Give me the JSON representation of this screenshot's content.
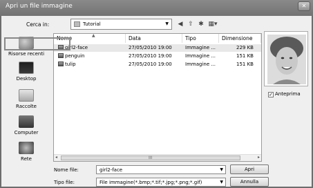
{
  "window": {
    "title": "Apri un file immagine",
    "close": "✕"
  },
  "lookin": {
    "label": "Cerca in:",
    "value": "Tutorial"
  },
  "toolbar": {
    "back": "◀",
    "up": "⇧",
    "newfolder": "✱",
    "views": "▦▾"
  },
  "places": [
    {
      "label": "Risorse recenti",
      "icon": "recent-places-icon"
    },
    {
      "label": "Desktop",
      "icon": "desktop-icon"
    },
    {
      "label": "Raccolte",
      "icon": "libraries-icon"
    },
    {
      "label": "Computer",
      "icon": "computer-icon"
    },
    {
      "label": "Rete",
      "icon": "network-icon"
    }
  ],
  "columns": [
    "Nome",
    "Data",
    "Tipo",
    "Dimensione"
  ],
  "files": [
    {
      "name": "girl2-face",
      "date": "27/05/2010 19:00",
      "type": "Immagine ...",
      "size": "229 KB",
      "selected": true
    },
    {
      "name": "penguin",
      "date": "27/05/2010 19:00",
      "type": "Immagine ...",
      "size": "151 KB",
      "selected": false
    },
    {
      "name": "tulip",
      "date": "27/05/2010 19:00",
      "type": "Immagine ...",
      "size": "151 KB",
      "selected": false
    }
  ],
  "scrollbar": {
    "left": "◂",
    "grip": "III",
    "right": "▸"
  },
  "preview": {
    "label": "Anteprima",
    "checked": true,
    "checkmark": "✓"
  },
  "filename": {
    "label": "Nome file:",
    "value": "girl2-face"
  },
  "filetype": {
    "label": "Tipo file:",
    "value": "File immagine(*.bmp;*.tif;*.jpg;*.png;*.gif)"
  },
  "buttons": {
    "open": "Apri",
    "cancel": "Annulla"
  },
  "colors": {
    "accent": "#6d6d6d",
    "background": "#efefef"
  }
}
